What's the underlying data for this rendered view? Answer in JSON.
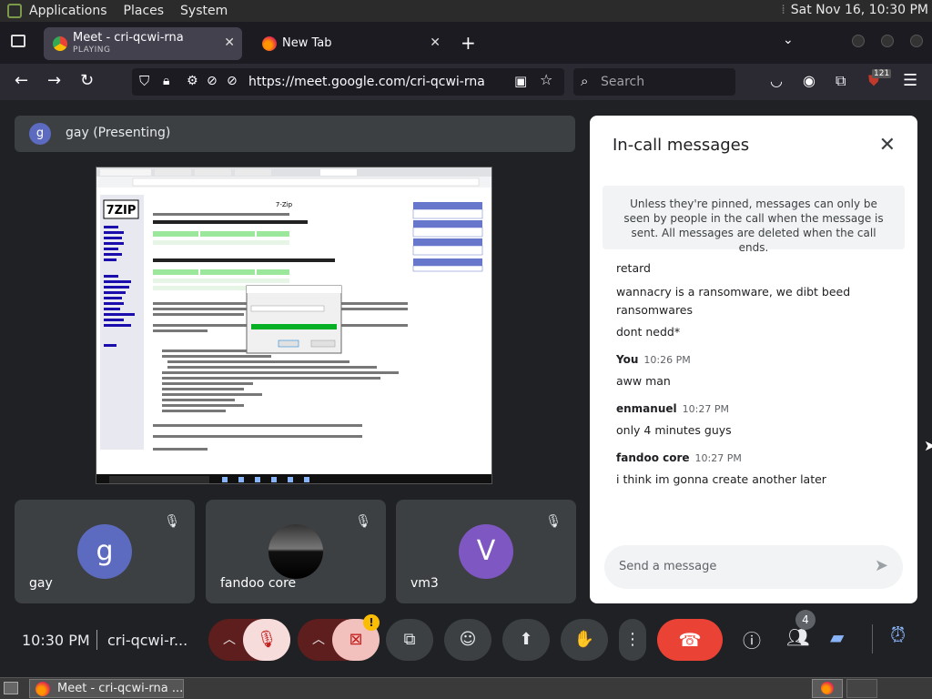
{
  "desktop_panel": {
    "menus": [
      "Applications",
      "Places",
      "System"
    ],
    "clock": "Sat Nov 16, 10:30 PM"
  },
  "browser": {
    "tabs": [
      {
        "title": "Meet - cri-qcwi-rna",
        "subtitle": "PLAYING",
        "active": true
      },
      {
        "title": "New Tab",
        "subtitle": "",
        "active": false
      }
    ],
    "url": "https://meet.google.com/cri-qcwi-rna",
    "search_placeholder": "Search",
    "extension_badge": "121"
  },
  "meet": {
    "presenter": {
      "initial": "g",
      "label": "gay (Presenting)"
    },
    "participants": [
      {
        "name": "gay",
        "initial": "g",
        "avatar_color": "#5c6bc0",
        "muted": true
      },
      {
        "name": "fandoo core",
        "initial": "",
        "avatar_color": "#222222",
        "muted": true
      },
      {
        "name": "vm3",
        "initial": "V",
        "avatar_color": "#7e57c2",
        "muted": true
      }
    ],
    "chat": {
      "title": "In-call messages",
      "notice": "Unless they're pinned, messages can only be seen by people in the call when the message is sent. All messages are deleted when the call ends.",
      "messages": [
        {
          "sender": "",
          "time": "",
          "lines": [
            "retard",
            "wannacry is a ransomware, we dibt beed ransomwares",
            "dont nedd*"
          ]
        },
        {
          "sender": "You",
          "time": "10:26 PM",
          "lines": [
            "aww man"
          ]
        },
        {
          "sender": "enmanuel",
          "time": "10:27 PM",
          "lines": [
            "only 4 minutes guys"
          ]
        },
        {
          "sender": "fandoo core",
          "time": "10:27 PM",
          "lines": [
            "i think im gonna create another later"
          ]
        }
      ],
      "input_placeholder": "Send a message"
    },
    "controls": {
      "time": "10:30 PM",
      "room": "cri-qcwi-r...",
      "people_count": "4",
      "warning_mark": "!"
    }
  },
  "shared_screen": {
    "app_title": "7-Zip",
    "logo": "7ZIP"
  },
  "taskbar": {
    "item": "Meet - cri-qcwi-rna ..."
  },
  "colors": {
    "background": "#202124",
    "tile": "#3c4043",
    "red": "#ea4335",
    "accent": "#1a73e8"
  }
}
